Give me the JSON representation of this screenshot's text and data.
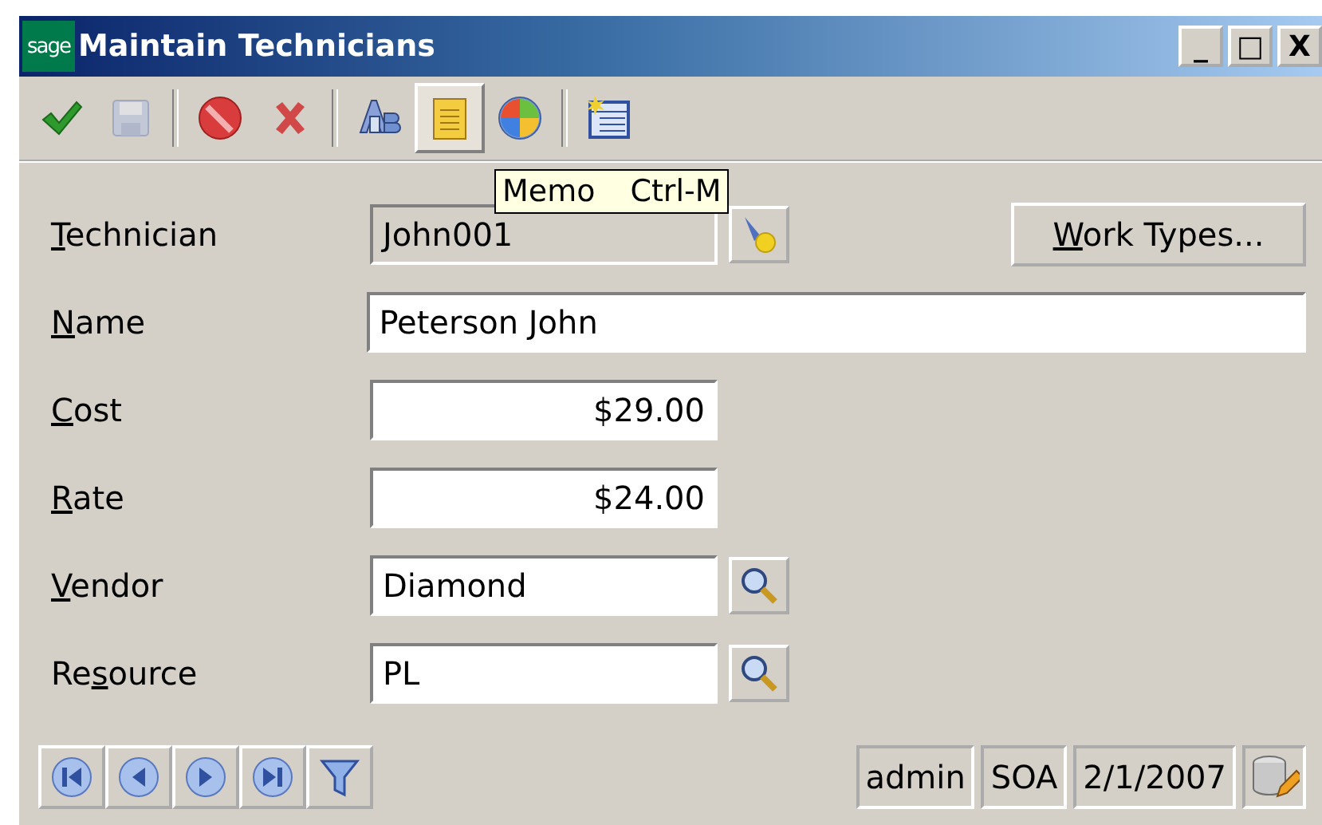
{
  "window": {
    "logo": "sage",
    "title": "Maintain Technicians",
    "controls": [
      "_",
      "□",
      "X"
    ]
  },
  "toolbar": [
    {
      "kind": "accept",
      "disabled": false,
      "highlighted": false
    },
    {
      "kind": "save",
      "disabled": true,
      "highlighted": false
    },
    {
      "kind": "sep"
    },
    {
      "kind": "cancel",
      "disabled": false,
      "highlighted": false
    },
    {
      "kind": "delete",
      "disabled": false,
      "highlighted": false
    },
    {
      "kind": "sep"
    },
    {
      "kind": "spell",
      "disabled": false,
      "highlighted": false
    },
    {
      "kind": "memo",
      "disabled": false,
      "highlighted": true
    },
    {
      "kind": "globe",
      "disabled": false,
      "highlighted": false
    },
    {
      "kind": "sep"
    },
    {
      "kind": "grid",
      "disabled": false,
      "highlighted": false
    }
  ],
  "fields": [
    {
      "label": [
        {
          "text": "T",
          "underlined": true
        },
        {
          "text": "echnician",
          "underlined": false
        }
      ],
      "kind": "readonly",
      "value": "John001"
    },
    {
      "label": [
        {
          "text": "N",
          "underlined": true
        },
        {
          "text": "ame",
          "underlined": false
        }
      ],
      "kind": "wide",
      "value": "Peterson John"
    },
    {
      "label": [
        {
          "text": "C",
          "underlined": true
        },
        {
          "text": "ost",
          "underlined": false
        }
      ],
      "kind": "money",
      "value": "$29.00"
    },
    {
      "label": [
        {
          "text": "R",
          "underlined": true
        },
        {
          "text": "ate",
          "underlined": false
        }
      ],
      "kind": "money",
      "value": "$24.00"
    },
    {
      "label": [
        {
          "text": "V",
          "underlined": true
        },
        {
          "text": "endor",
          "underlined": false
        }
      ],
      "kind": "lookup",
      "value": "Diamond"
    },
    {
      "label": [
        {
          "text": "Re",
          "underlined": false
        },
        {
          "text": "s",
          "underlined": true
        },
        {
          "text": "ource",
          "underlined": false
        }
      ],
      "kind": "lookup",
      "value": "PL"
    }
  ],
  "work_types_button": {
    "label": [
      {
        "text": "W",
        "underlined": true
      },
      {
        "text": "ork Types...",
        "underlined": false
      }
    ]
  },
  "tooltip": {
    "label": "Memo",
    "shortcut": "Ctrl-M"
  },
  "nav": [
    {
      "kind": "first"
    },
    {
      "kind": "prev"
    },
    {
      "kind": "next"
    },
    {
      "kind": "last"
    },
    {
      "kind": "filter"
    }
  ],
  "status": [
    "admin",
    "SOA",
    "2/1/2007"
  ]
}
